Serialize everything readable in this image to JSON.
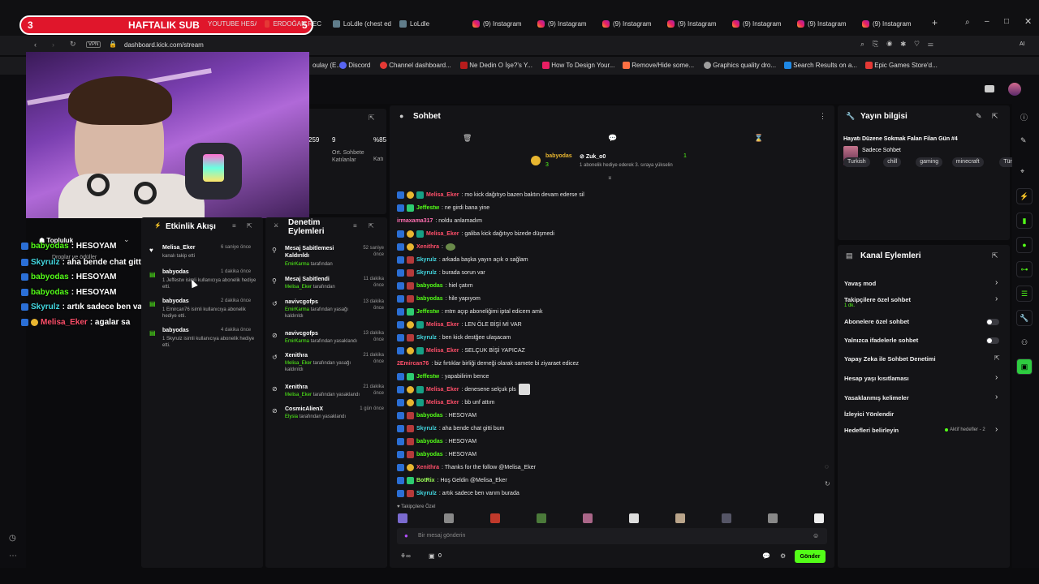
{
  "browser": {
    "tabs": [
      {
        "label": "HAFTALIK SUB",
        "count_left": "3",
        "count_right": "5"
      },
      {
        "label": "YOUTUBE HESAP"
      },
      {
        "label": "ERDOĞAN REC"
      },
      {
        "label": "LoLdle (chest ed"
      },
      {
        "label": "LoLdle"
      },
      {
        "label": "(9) Instagram"
      },
      {
        "label": "(9) Instagram"
      },
      {
        "label": "(9) Instagram"
      },
      {
        "label": "(9) Instagram"
      },
      {
        "label": "(9) Instagram"
      },
      {
        "label": "(9) Instagram"
      },
      {
        "label": "(9) Instagram"
      }
    ],
    "vpn": "VPN",
    "url": "dashboard.kick.com/stream",
    "bookmarks": [
      "Discord",
      "Channel dashboard...",
      "Ne Dedin O İşe?'s Y...",
      "How To Design Your...",
      "Remove/Hide some...",
      "Graphics quality dro...",
      "Search Results on a...",
      "Epic Games Store'd..."
    ],
    "bookmark_first": "oulay (E..."
  },
  "stats": {
    "value_a": "259",
    "value_b": "9",
    "value_c": "%85",
    "label_b": "Ort. Sohbete Katılanlar",
    "label_c": "Katı"
  },
  "overlay_chat": [
    {
      "user": "babyodas",
      "text": ": HESOYAM"
    },
    {
      "user": "Skyrulz",
      "text": ": aha bende chat gitti bum"
    },
    {
      "user": "babyodas",
      "text": ": HESOYAM"
    },
    {
      "user": "babyodas",
      "text": ": HESOYAM"
    },
    {
      "user": "Skyrulz",
      "text": ": artık sadece ben varım burada"
    },
    {
      "user": "Melisa_Eker",
      "text": ": agalar sa"
    }
  ],
  "overlay_labels": {
    "topluluk": "Topluluk",
    "droplar": "Droplar ve ödüller",
    "sohbetler": "Sohbetler"
  },
  "activity": {
    "title": "Etkinlik Akışı",
    "items": [
      {
        "user": "Melisa_Eker",
        "detail": "kanalı takip etti",
        "time": "6 saniye önce"
      },
      {
        "user": "babyodas",
        "detail": "1 Jeffestw isimli kullanıcıya abonelik hediye etti.",
        "time": "1 dakika önce"
      },
      {
        "user": "babyodas",
        "detail": "1 Emircan76 isimli kullanıcıya abonelik hediye etti.",
        "time": "2 dakika önce"
      },
      {
        "user": "babyodas",
        "detail": "1 Skyrulz isimli kullanıcıya abonelik hediye etti.",
        "time": "4 dakika önce"
      }
    ]
  },
  "moderation": {
    "title": "Denetim Eylemleri",
    "items": [
      {
        "title": "Mesaj Sabitlemesi Kaldırıldı",
        "by": "EmirKarma",
        "suffix": "tarafından",
        "time": "52 saniye önce"
      },
      {
        "title": "Mesaj Sabitlendi",
        "by": "Melisa_Eker",
        "suffix": "tarafından",
        "time": "11 dakika önce"
      },
      {
        "title": "navivcgofps",
        "by": "EmirKarma",
        "suffix": "tarafından yasağı kaldırıldı",
        "time": "13 dakika önce"
      },
      {
        "title": "navivcgofps",
        "by": "EmirKarma",
        "suffix": "tarafından yasaklandı",
        "time": "13 dakika önce"
      },
      {
        "title": "Xenithra",
        "by": "Melisa_Eker",
        "suffix": "tarafından yasağı kaldırıldı",
        "time": "21 dakika önce"
      },
      {
        "title": "Xenithra",
        "by": "Melisa_Eker",
        "suffix": "tarafından yasaklandı",
        "time": "21 dakika önce"
      },
      {
        "title": "CosmicAlienX",
        "by": "Elysia",
        "suffix": "tarafından yasaklandı",
        "time": "1 gün önce"
      }
    ]
  },
  "chat": {
    "title": "Sohbet",
    "pinned_user": "babyodas",
    "pinned_target": "Zuk_o0",
    "pinned_text": "1 abonelik hediye ederek 3. sıraya yükselin",
    "pinned_count_left": "3",
    "pinned_count_right": "1",
    "messages": [
      {
        "user": "Melisa_Eker",
        "color": "u-red",
        "text": ": mo kick dağıtıyo bazen baktın devam ederse sil"
      },
      {
        "user": "Jeffestw",
        "color": "u-grn",
        "text": ": ne girdi bana yine"
      },
      {
        "user": "irmaxama317",
        "color": "u-pink",
        "text": ": noldu anlamadım"
      },
      {
        "user": "Melisa_Eker",
        "color": "u-red",
        "text": ": galiba kick dağıtıyo bizede düşmedi"
      },
      {
        "user": "Xenithra",
        "color": "u-red",
        "text": ":"
      },
      {
        "user": "Skyrulz",
        "color": "u-cyan",
        "text": ": arkada başka yayın açık o sağlam"
      },
      {
        "user": "Skyrulz",
        "color": "u-cyan",
        "text": ": burada sorun var"
      },
      {
        "user": "babyodas",
        "color": "u-grn",
        "text": ": hiel çatım"
      },
      {
        "user": "babyodas",
        "color": "u-grn",
        "text": ": hile yapıyom"
      },
      {
        "user": "Jeffestw",
        "color": "u-grn",
        "text": ": mtm açıp aboneliğimi iptal edicem amk"
      },
      {
        "user": "Melisa_Eker",
        "color": "u-red",
        "text": ": LEN ÖLE BİŞİ Mİ VAR"
      },
      {
        "user": "Skyrulz",
        "color": "u-cyan",
        "text": ": ben kick destğee ulaşacam"
      },
      {
        "user": "Melisa_Eker",
        "color": "u-red",
        "text": ": SELÇUK BİŞİ YAPICAZ"
      },
      {
        "user": "2Emircan76",
        "color": "u-red",
        "text": ": biz fırtıklar birliği derneği olarak samete bi ziyaraet edicez"
      },
      {
        "user": "Jeffestw",
        "color": "u-grn",
        "text": ": yapabilirim bence"
      },
      {
        "user": "Melisa_Eker",
        "color": "u-red",
        "text": ": denesene selçuk pls"
      },
      {
        "user": "Melisa_Eker",
        "color": "u-red",
        "text": ": bb unf attım"
      },
      {
        "user": "babyodas",
        "color": "u-grn",
        "text": ": HESOYAM"
      },
      {
        "user": "Skyrulz",
        "color": "u-cyan",
        "text": ": aha bende chat gitti bum"
      },
      {
        "user": "babyodas",
        "color": "u-grn",
        "text": ": HESOYAM"
      },
      {
        "user": "babyodas",
        "color": "u-grn",
        "text": ": HESOYAM"
      },
      {
        "user": "Xenithra",
        "color": "u-red",
        "text": ": Thanks for the follow @Melisa_Eker"
      },
      {
        "user": "BotRix",
        "color": "u-lime",
        "text": ": Hoş Geldin @Melisa_Eker"
      },
      {
        "user": "Skyrulz",
        "color": "u-cyan",
        "text": ": artık sadece ben varım burada"
      }
    ],
    "followers_only": "Takipçilere Özel",
    "input_placeholder": "Bir mesaj gönderin",
    "count": "0",
    "send_label": "Gönder"
  },
  "stream_info": {
    "title": "Yayın bilgisi",
    "stream_title": "Hayatı Düzene Sokmak Falan Filan Gün #4",
    "category": "Sadece Sohbet",
    "tags": [
      "Turkish",
      "chill",
      "gaming",
      "minecraft",
      "Türkç"
    ]
  },
  "channel_actions": {
    "title": "Kanal Eylemleri",
    "items": [
      {
        "label": "Yavaş mod",
        "control": "chevron"
      },
      {
        "label": "Takipçilere özel sohbet",
        "sub": "1 dk.",
        "control": "chevron"
      },
      {
        "label": "Abonelere özel sohbet",
        "control": "toggle"
      },
      {
        "label": "Yalnızca ifadelerle sohbet",
        "control": "toggle"
      },
      {
        "label": "Yapay Zeka ile Sohbet Denetimi",
        "control": "external"
      },
      {
        "label": "Hesap yaşı kısıtlaması",
        "control": "chevron"
      },
      {
        "label": "Yasaklanmış kelimeler",
        "control": "chevron"
      },
      {
        "label": "İzleyici Yönlendir",
        "control": "none"
      },
      {
        "label": "Hedefleri belirleyin",
        "control": "chevron",
        "status": "Aktif hedefler - 2"
      }
    ]
  },
  "colors": {
    "accent": "#53fc18",
    "panel": "#141417",
    "bg": "#0b0b0d"
  }
}
